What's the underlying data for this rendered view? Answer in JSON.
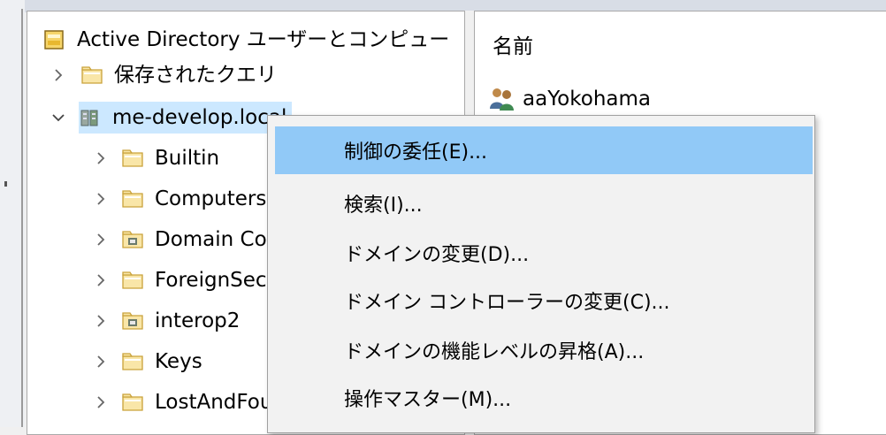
{
  "tree": {
    "root_label": "Active Directory ユーザーとコンピュー",
    "saved_queries_label": "保存されたクエリ",
    "domain_label": "me-develop.local",
    "children": [
      {
        "label": "Builtin",
        "icon": "folder-icon"
      },
      {
        "label": "Computers",
        "icon": "folder-icon"
      },
      {
        "label": "Domain Controllers",
        "icon": "ou-folder-icon"
      },
      {
        "label": "ForeignSecurityPrincipals",
        "icon": "folder-icon"
      },
      {
        "label": "interop2",
        "icon": "ou-folder-icon"
      },
      {
        "label": "Keys",
        "icon": "folder-icon"
      },
      {
        "label": "LostAndFound",
        "icon": "folder-icon"
      }
    ]
  },
  "list": {
    "column_name": "名前",
    "rows": [
      {
        "label": "aaYokohama",
        "icon": "group-icon"
      }
    ]
  },
  "context_menu": {
    "items": [
      {
        "label": "制御の委任(E)..."
      },
      {
        "label": "検索(I)..."
      },
      {
        "label": "ドメインの変更(D)..."
      },
      {
        "label": "ドメイン コントローラーの変更(C)..."
      },
      {
        "label": "ドメインの機能レベルの昇格(A)..."
      },
      {
        "label": "操作マスター(M)..."
      }
    ],
    "highlighted_index": 0
  },
  "colors": {
    "selection": "#cce8ff",
    "menu_highlight": "#91c9f7",
    "menu_background": "#f2f2f2"
  }
}
